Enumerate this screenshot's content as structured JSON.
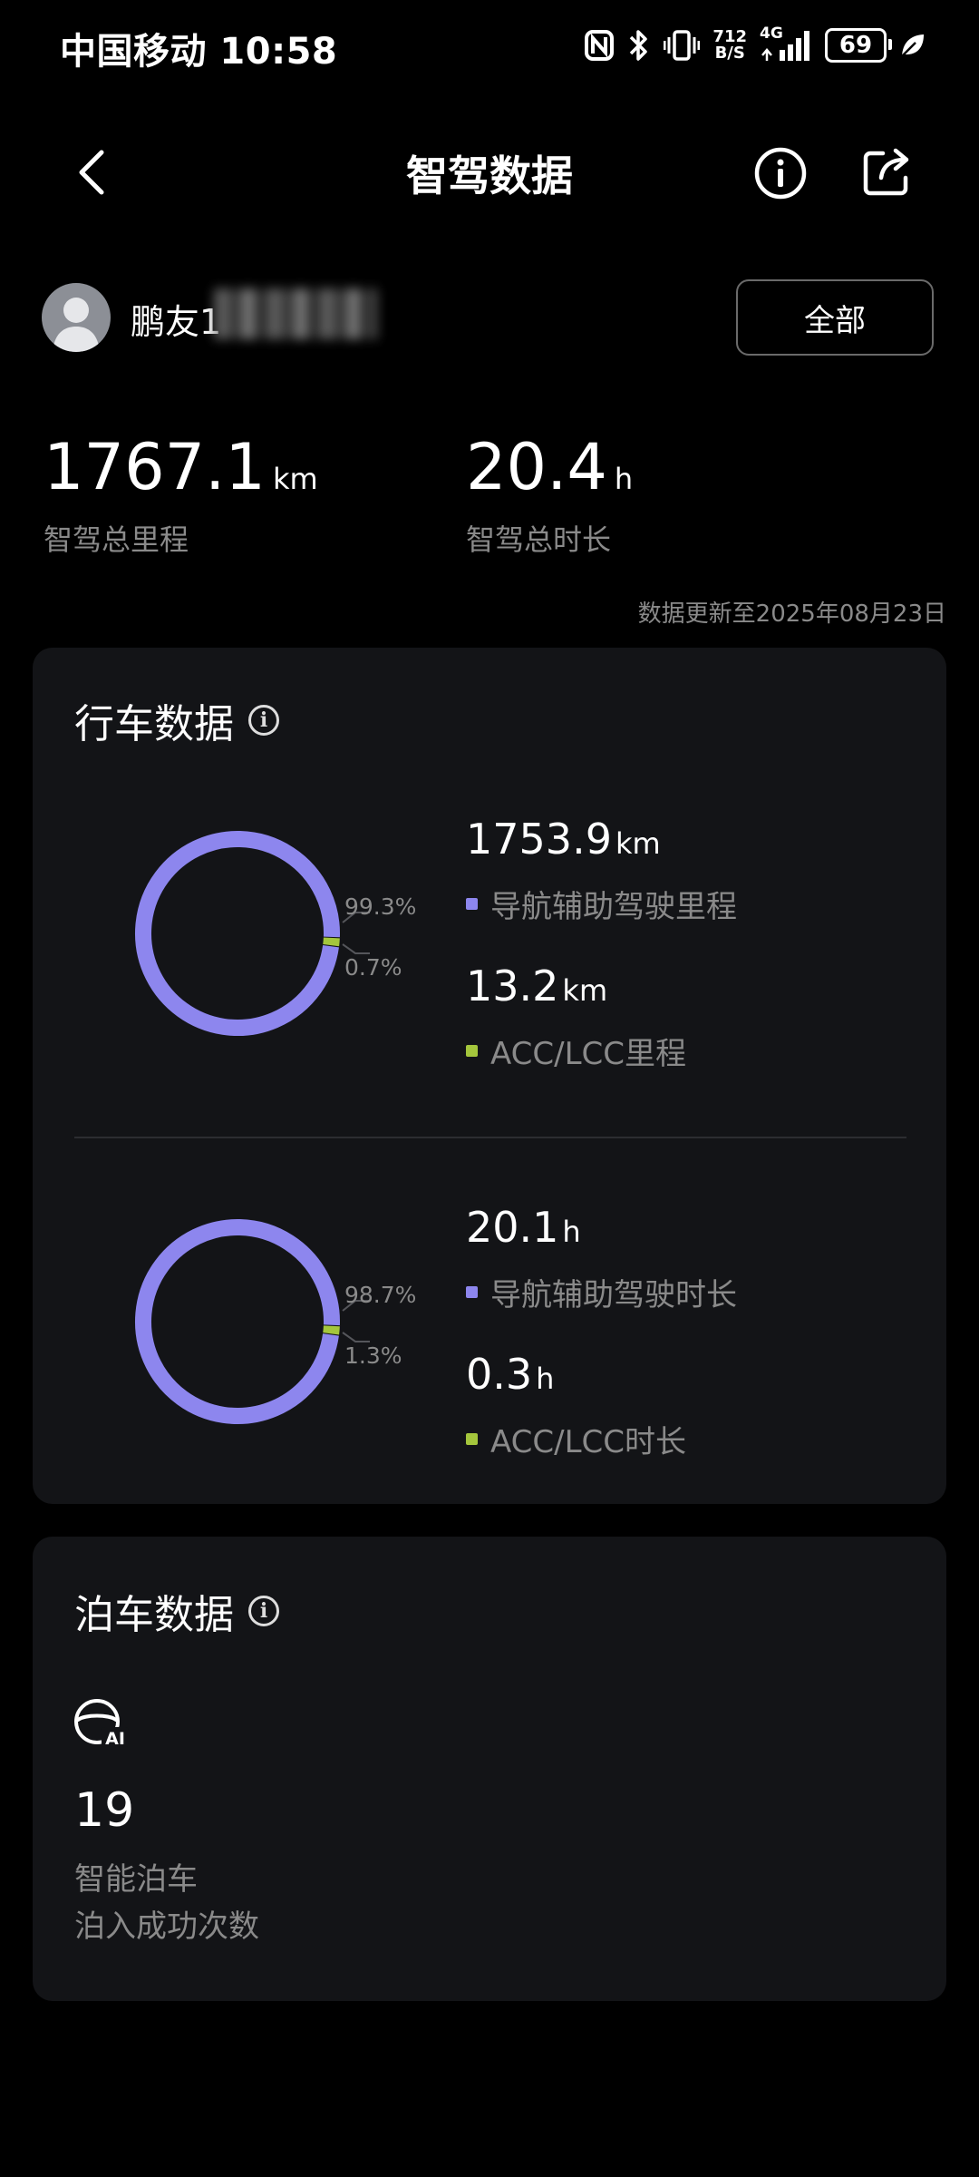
{
  "status_bar": {
    "carrier_time": "中国移动 10:58",
    "net_speed_top": "712",
    "net_speed_bottom": "B/S",
    "network": "4G",
    "battery": "69"
  },
  "header": {
    "title": "智驾数据"
  },
  "user": {
    "name": "鹏友1",
    "filter_label": "全部"
  },
  "summary": {
    "total_distance": {
      "value": "1767.1",
      "unit": "km",
      "label": "智驾总里程"
    },
    "total_duration": {
      "value": "20.4",
      "unit": "h",
      "label": "智驾总时长"
    },
    "update_note": "数据更新至2025年08月23日"
  },
  "driving": {
    "title": "行车数据",
    "distance": {
      "nav": {
        "value": "1753.9",
        "unit": "km",
        "label": "导航辅助驾驶里程",
        "percent": "99.3%"
      },
      "acc": {
        "value": "13.2",
        "unit": "km",
        "label": "ACC/LCC里程",
        "percent": "0.7%"
      }
    },
    "duration": {
      "nav": {
        "value": "20.1",
        "unit": "h",
        "label": "导航辅助驾驶时长",
        "percent": "98.7%"
      },
      "acc": {
        "value": "0.3",
        "unit": "h",
        "label": "ACC/LCC时长",
        "percent": "1.3%"
      }
    }
  },
  "parking": {
    "title": "泊车数据",
    "count": "19",
    "label_1": "智能泊车",
    "label_2": "泊入成功次数"
  },
  "chart_data": [
    {
      "type": "pie",
      "categories": [
        "导航辅助驾驶里程",
        "ACC/LCC里程"
      ],
      "values": [
        99.3,
        0.7
      ],
      "colors": [
        "#8d86ee",
        "#a4c63c"
      ]
    },
    {
      "type": "pie",
      "categories": [
        "导航辅助驾驶时长",
        "ACC/LCC时长"
      ],
      "values": [
        98.7,
        1.3
      ],
      "colors": [
        "#8d86ee",
        "#a4c63c"
      ]
    }
  ],
  "colors": {
    "nav": "#8d86ee",
    "acc": "#a4c63c",
    "card_bg": "#131417"
  }
}
